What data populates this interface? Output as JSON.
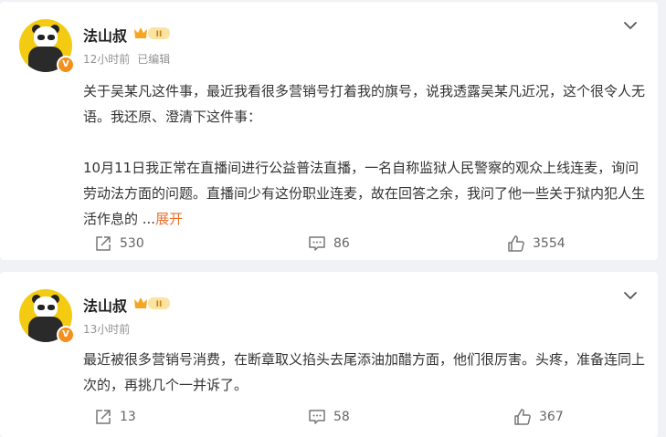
{
  "posts": [
    {
      "author": "法山叔",
      "time": "12小时前",
      "edited": "已编辑",
      "badge": "V",
      "level_text": "II",
      "paragraphs": [
        "关于吴某凡这件事，最近我看很多营销号打着我的旗号，说我透露吴某凡近况，这个很令人无语。我还原、澄清下这件事：",
        "",
        "10月11日我正常在直播间进行公益普法直播，一名自称监狱人民警察的观众上线连麦，询问劳动法方面的问题。直播间少有这份职业连麦，故在回答之余，我问了他一些关于狱内犯人生活作息的 ..."
      ],
      "expand_label": "展开",
      "reposts": "530",
      "comments": "86",
      "likes": "3554"
    },
    {
      "author": "法山叔",
      "time": "13小时前",
      "badge": "V",
      "level_text": "II",
      "paragraphs": [
        "最近被很多营销号消费，在断章取义掐头去尾添油加醋方面，他们很厉害。头疼，准备连同上次的，再挑几个一并诉了。"
      ],
      "reposts": "13",
      "comments": "58",
      "likes": "367"
    }
  ],
  "icons": {
    "more": "chevron-down-icon",
    "repost": "share-icon",
    "comment": "comment-icon",
    "like": "thumbs-up-icon"
  },
  "colors": {
    "accent": "#e8712d",
    "verified": "#f58f1c",
    "avatar_bg": "#f3cb12",
    "crown": "#f6a623"
  }
}
